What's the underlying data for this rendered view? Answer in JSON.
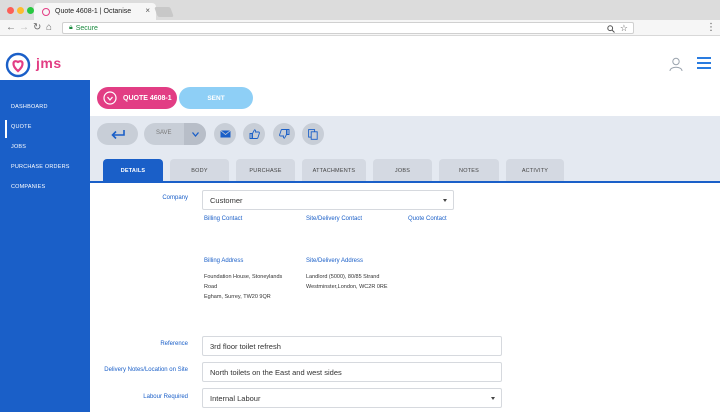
{
  "browser": {
    "tab_title": "Quote 4608-1 | Octanise",
    "tab_close": "×",
    "secure_label": "Secure"
  },
  "app": {
    "logo_text": "jms"
  },
  "sidebar": {
    "items": [
      {
        "label": "DASHBOARD"
      },
      {
        "label": "QUOTE"
      },
      {
        "label": "JOBS"
      },
      {
        "label": "PURCHASE ORDERS"
      },
      {
        "label": "COMPANIES"
      }
    ],
    "active_index": 1
  },
  "quote": {
    "label": "QUOTE 4608-1",
    "status": "SENT"
  },
  "toolbar": {
    "save_label": "SAVE"
  },
  "tabs": [
    {
      "label": "DETAILS"
    },
    {
      "label": "BODY"
    },
    {
      "label": "PURCHASE"
    },
    {
      "label": "ATTACHMENTS"
    },
    {
      "label": "JOBS"
    },
    {
      "label": "NOTES"
    },
    {
      "label": "ACTIVITY"
    }
  ],
  "active_tab": "DETAILS",
  "form": {
    "company": {
      "label": "Company",
      "value": "Customer"
    },
    "contacts": {
      "billing": "Billing Contact",
      "site_delivery": "Site/Delivery Contact",
      "quote": "Quote Contact"
    },
    "addresses": {
      "billing_label": "Billing Address",
      "billing_lines": [
        "Foundation House, Stoneylands",
        "Road",
        "Egham, Surrey, TW20 9QR"
      ],
      "site_label": "Site/Delivery Address",
      "site_lines": [
        "Landlord (5000), 80/85 Strand",
        "Westminster,London, WC2R 0RE"
      ]
    },
    "reference": {
      "label": "Reference",
      "value": "3rd floor toilet refresh"
    },
    "delivery_notes": {
      "label": "Delivery Notes/Location on Site",
      "value": "North toilets on the East and west sides"
    },
    "labour_required": {
      "label": "Labour Required",
      "value": "Internal Labour"
    }
  },
  "colors": {
    "brand_pink": "#e23d84",
    "brand_blue": "#1a5fc8",
    "status_blue": "#8ecff6"
  }
}
